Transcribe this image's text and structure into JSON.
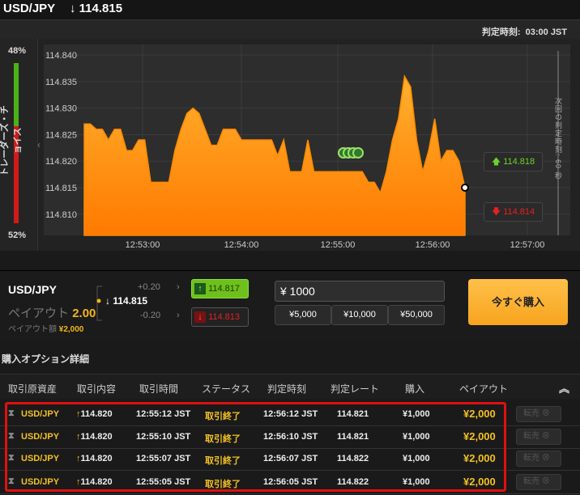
{
  "header": {
    "pair": "USD/JPY",
    "rate_arrow": "↓",
    "rate": "114.815",
    "expiry_label": "判定時刻:",
    "expiry_time": "03:00 JST"
  },
  "trader_choice": {
    "top_pct": "48%",
    "bottom_pct": "52%",
    "label": "トレーダーズ・チョイス",
    "green_fraction": 0.48
  },
  "chart_data": {
    "type": "area",
    "y_ticks": [
      "114.840",
      "114.835",
      "114.830",
      "114.825",
      "114.820",
      "114.815",
      "114.810"
    ],
    "ylim": [
      114.806,
      114.842
    ],
    "x_ticks": [
      "12:53:00",
      "12:54:00",
      "12:55:00",
      "12:56:00",
      "12:57:00"
    ],
    "series": [
      {
        "values": [
          114.827,
          114.827,
          114.826,
          114.826,
          114.824,
          114.826,
          114.826,
          114.822,
          114.822,
          114.824,
          114.824,
          114.816,
          114.816,
          114.816,
          114.816,
          114.822,
          114.826,
          114.829,
          114.83,
          114.829,
          114.826,
          114.823,
          114.823,
          114.826,
          114.826,
          114.826,
          114.824,
          114.824,
          114.824,
          114.824,
          114.824,
          114.824,
          114.821,
          114.824,
          114.818,
          114.818,
          114.818,
          114.824,
          114.818,
          114.818,
          114.818,
          114.818,
          114.818,
          114.818,
          114.818,
          114.818,
          114.818,
          114.816,
          114.816,
          114.814,
          114.818,
          114.824,
          114.828,
          114.836,
          114.834,
          114.824,
          114.818,
          114.822,
          114.828,
          114.82,
          114.822,
          114.822,
          114.82,
          114.815
        ]
      }
    ],
    "current_price": "114.815",
    "call_strike": "114.818",
    "put_strike": "114.814",
    "next_expiry": "次回の判定時刻: 60 秒"
  },
  "order_panel": {
    "pair": "USD/JPY",
    "rate_arrow": "↓",
    "rate": "114.815",
    "offset_up": "+0.20",
    "offset_down": "-0.20",
    "payout_label": "ペイアウト",
    "payout_value": "2.00",
    "payout_amount_label": "ペイアウト額",
    "payout_amount": "¥2,000",
    "call_price": "114.817",
    "put_price": "114.813",
    "amount": "¥ 1000",
    "presets": [
      "¥5,000",
      "¥10,000",
      "¥50,000"
    ],
    "buy_label": "今すぐ購入"
  },
  "details": {
    "title": "購入オプション詳細",
    "columns": [
      "取引原資産",
      "取引内容",
      "取引時間",
      "ステータス",
      "判定時刻",
      "判定レート",
      "購入",
      "ペイアウト"
    ],
    "collapse_icon": "chevron-up-double",
    "resell_label": "転売",
    "rows": [
      {
        "asset": "USD/JPY",
        "direction": "↑",
        "rate": "114.820",
        "time": "12:55:12 JST",
        "status": "取引終了",
        "expiry": "12:56:12 JST",
        "exp_rate": "114.821",
        "purchase": "¥1,000",
        "payout": "¥2,000"
      },
      {
        "asset": "USD/JPY",
        "direction": "↑",
        "rate": "114.820",
        "time": "12:55:10 JST",
        "status": "取引終了",
        "expiry": "12:56:10 JST",
        "exp_rate": "114.821",
        "purchase": "¥1,000",
        "payout": "¥2,000"
      },
      {
        "asset": "USD/JPY",
        "direction": "↑",
        "rate": "114.820",
        "time": "12:55:07 JST",
        "status": "取引終了",
        "expiry": "12:56:07 JST",
        "exp_rate": "114.822",
        "purchase": "¥1,000",
        "payout": "¥2,000"
      },
      {
        "asset": "USD/JPY",
        "direction": "↑",
        "rate": "114.820",
        "time": "12:55:05 JST",
        "status": "取引終了",
        "expiry": "12:56:05 JST",
        "exp_rate": "114.822",
        "purchase": "¥1,000",
        "payout": "¥2,000"
      }
    ]
  }
}
